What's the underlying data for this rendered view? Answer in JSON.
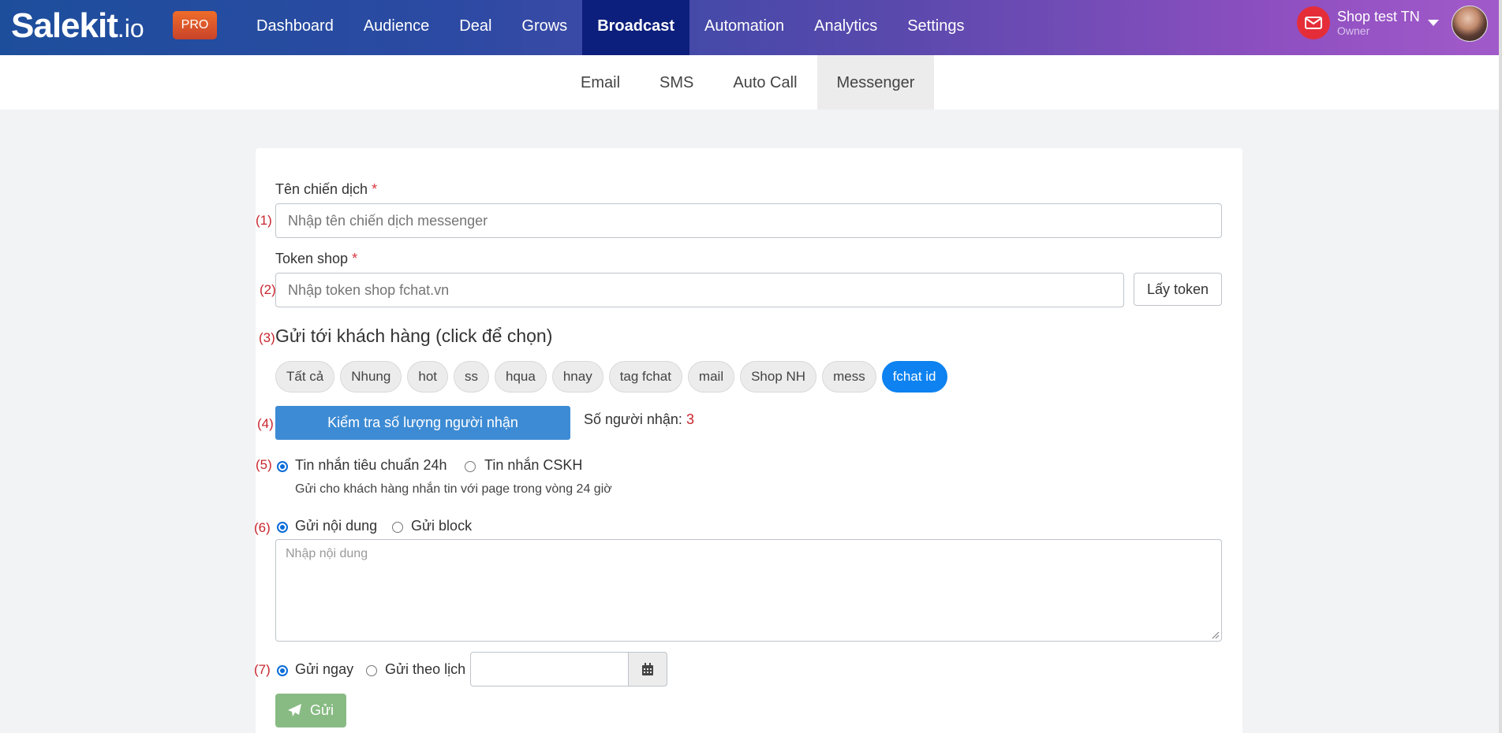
{
  "app": {
    "logo_brand": "Salekit",
    "logo_tld": ".io",
    "pro_badge": "PRO"
  },
  "nav": {
    "items": [
      {
        "label": "Dashboard"
      },
      {
        "label": "Audience"
      },
      {
        "label": "Deal"
      },
      {
        "label": "Grows"
      },
      {
        "label": "Broadcast",
        "active": true
      },
      {
        "label": "Automation"
      },
      {
        "label": "Analytics"
      },
      {
        "label": "Settings"
      }
    ]
  },
  "account": {
    "name": "Shop test TN",
    "role": "Owner",
    "icon": "mail-icon"
  },
  "subnav": {
    "items": [
      {
        "label": "Email"
      },
      {
        "label": "SMS"
      },
      {
        "label": "Auto Call"
      },
      {
        "label": "Messenger",
        "active": true
      }
    ]
  },
  "form": {
    "campaign": {
      "number": "(1)",
      "label": "Tên chiến dịch",
      "required_mark": "*",
      "placeholder": "Nhập tên chiến dịch messenger"
    },
    "token": {
      "number": "(2)",
      "label": "Token shop",
      "required_mark": "*",
      "placeholder": "Nhập token shop fchat.vn",
      "button_label": "Lấy token"
    },
    "recipients": {
      "number": "(3)",
      "title": "Gửi tới khách hàng (click để chọn)",
      "tags": [
        {
          "label": "Tất cả"
        },
        {
          "label": "Nhung"
        },
        {
          "label": "hot"
        },
        {
          "label": "ss"
        },
        {
          "label": "hqua"
        },
        {
          "label": "hnay"
        },
        {
          "label": "tag fchat"
        },
        {
          "label": "mail"
        },
        {
          "label": "Shop NH"
        },
        {
          "label": "mess"
        },
        {
          "label": "fchat id",
          "active": true
        }
      ]
    },
    "check": {
      "number": "(4)",
      "button_label": "Kiểm tra số lượng người nhận",
      "count_label": "Số người nhận:",
      "count_value": "3"
    },
    "message_type": {
      "number": "(5)",
      "options": [
        "Tin nhắn tiêu chuẩn 24h",
        "Tin nhắn CSKH"
      ],
      "selected": "Tin nhắn tiêu chuẩn 24h",
      "hint": "Gửi cho khách hàng nhắn tin với page trong vòng 24 giờ"
    },
    "content": {
      "number": "(6)",
      "options": [
        "Gửi nội dung",
        "Gửi block"
      ],
      "selected": "Gửi nội dung",
      "placeholder": "Nhập nội dung"
    },
    "schedule": {
      "number": "(7)",
      "options": [
        "Gửi ngay",
        "Gửi theo lịch"
      ],
      "selected": "Gửi ngay",
      "date_value": "",
      "calendar_icon": "calendar-icon"
    },
    "send_button": {
      "label": "Gửi",
      "icon": "paper-plane-icon",
      "color": "#88bb83"
    }
  },
  "colors": {
    "nav_active": "#0c1f7c",
    "primary_button": "#3d8bd4",
    "tag_active": "#0d82f0",
    "number_red": "#c8262e"
  }
}
